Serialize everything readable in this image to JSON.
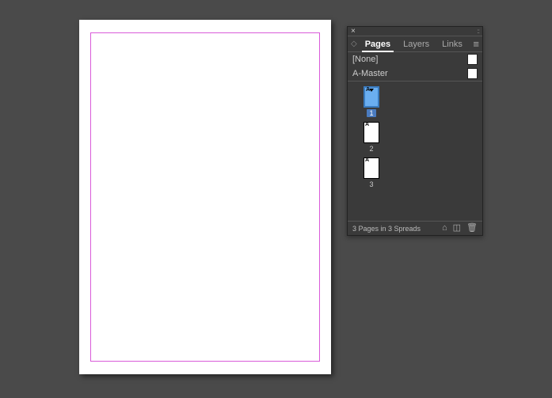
{
  "panel": {
    "tabs": [
      {
        "label": "Pages",
        "active": true
      },
      {
        "label": "Layers",
        "active": false
      },
      {
        "label": "Links",
        "active": false
      }
    ],
    "masters": [
      {
        "name": "[None]"
      },
      {
        "name": "A-Master"
      }
    ],
    "pages": [
      {
        "number": "1",
        "selected": true,
        "master_letter": "A"
      },
      {
        "number": "2",
        "selected": false,
        "master_letter": "A"
      },
      {
        "number": "3",
        "selected": false,
        "master_letter": "A"
      }
    ],
    "footer_status": "3 Pages in 3 Spreads"
  }
}
